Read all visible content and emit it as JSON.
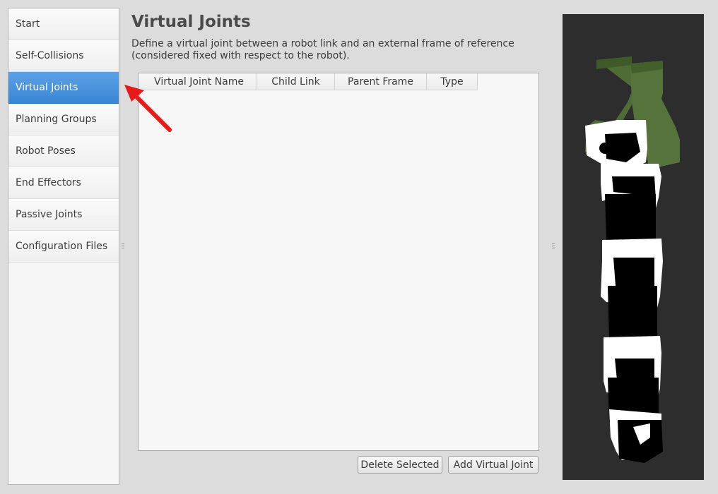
{
  "sidebar": {
    "items": [
      {
        "label": "Start",
        "active": false
      },
      {
        "label": "Self-Collisions",
        "active": false
      },
      {
        "label": "Virtual Joints",
        "active": true
      },
      {
        "label": "Planning Groups",
        "active": false
      },
      {
        "label": "Robot Poses",
        "active": false
      },
      {
        "label": "End Effectors",
        "active": false
      },
      {
        "label": "Passive Joints",
        "active": false
      },
      {
        "label": "Configuration Files",
        "active": false
      }
    ]
  },
  "main": {
    "title": "Virtual Joints",
    "description": "Define a virtual joint between a robot link and an external frame of reference (considered fixed with respect to the robot).",
    "table": {
      "columns": [
        "Virtual Joint Name",
        "Child Link",
        "Parent Frame",
        "Type"
      ],
      "rows": []
    },
    "buttons": {
      "delete_label": "Delete Selected",
      "add_label": "Add Virtual Joint"
    }
  },
  "colors": {
    "accent": "#3a86d4",
    "annotation_arrow": "#e8191a",
    "viewer_background": "#2d2d2d",
    "gripper_green": "#4d6b33"
  },
  "viewer": {
    "content": "robot-arm-3d-model"
  }
}
